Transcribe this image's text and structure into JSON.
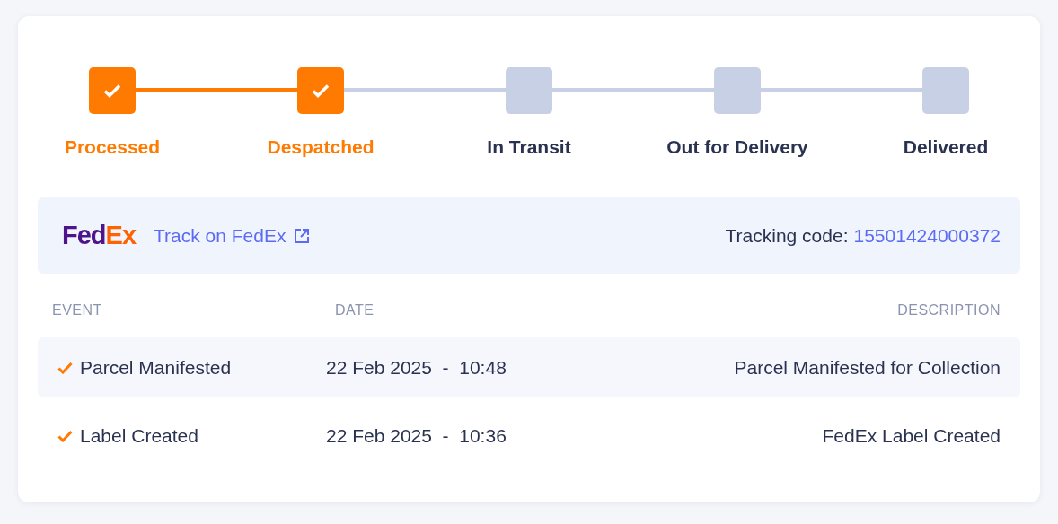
{
  "steps": [
    {
      "label": "Processed",
      "done": true
    },
    {
      "label": "Despatched",
      "done": true
    },
    {
      "label": "In Transit",
      "done": false
    },
    {
      "label": "Out for Delivery",
      "done": false
    },
    {
      "label": "Delivered",
      "done": false
    }
  ],
  "carrier": {
    "logo_parts": [
      "Fed",
      "Ex"
    ],
    "track_link": "Track on FedEx",
    "tracking_label": "Tracking code:",
    "tracking_code": "15501424000372"
  },
  "table": {
    "columns": [
      "EVENT",
      "DATE",
      "DESCRIPTION"
    ],
    "rows": [
      {
        "event": "Parcel Manifested",
        "date": "22 Feb 2025  -  10:48",
        "description": "Parcel Manifested for Collection",
        "checked": true
      },
      {
        "event": "Label Created",
        "date": "22 Feb 2025  -  10:36",
        "description": "FedEx Label Created",
        "checked": true
      }
    ]
  }
}
